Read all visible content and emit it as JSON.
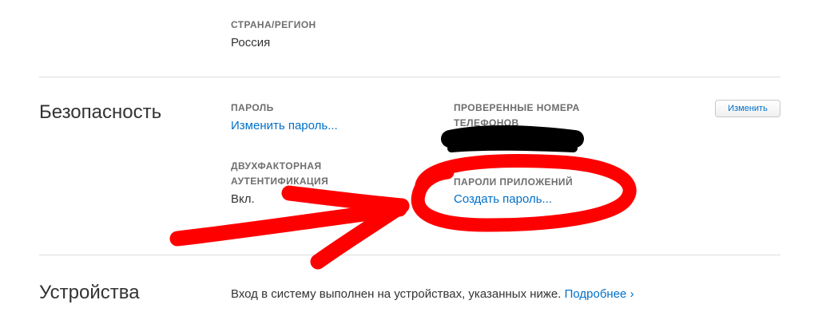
{
  "country": {
    "label": "СТРАНА/РЕГИОН",
    "value": "Россия"
  },
  "security": {
    "title": "Безопасность",
    "edit_button": "Изменить",
    "password": {
      "label": "ПАРОЛЬ",
      "link": "Изменить пароль..."
    },
    "trusted_phones": {
      "label_line1": "ПРОВЕРЕННЫЕ НОМЕРА",
      "label_line2": "ТЕЛЕФОНОВ"
    },
    "two_factor": {
      "label_line1": "ДВУХФАКТОРНАЯ",
      "label_line2": "АУТЕНТИФИКАЦИЯ",
      "value": "Вкл."
    },
    "app_passwords": {
      "label": "ПАРОЛИ ПРИЛОЖЕНИЙ",
      "link": "Создать пароль..."
    }
  },
  "devices": {
    "title": "Устройства",
    "description": "Вход в систему выполнен на устройствах, указанных ниже.",
    "more_link": "Подробнее ›"
  },
  "colors": {
    "link": "#0070c9",
    "annotation": "#ff0000",
    "redaction": "#000000"
  }
}
